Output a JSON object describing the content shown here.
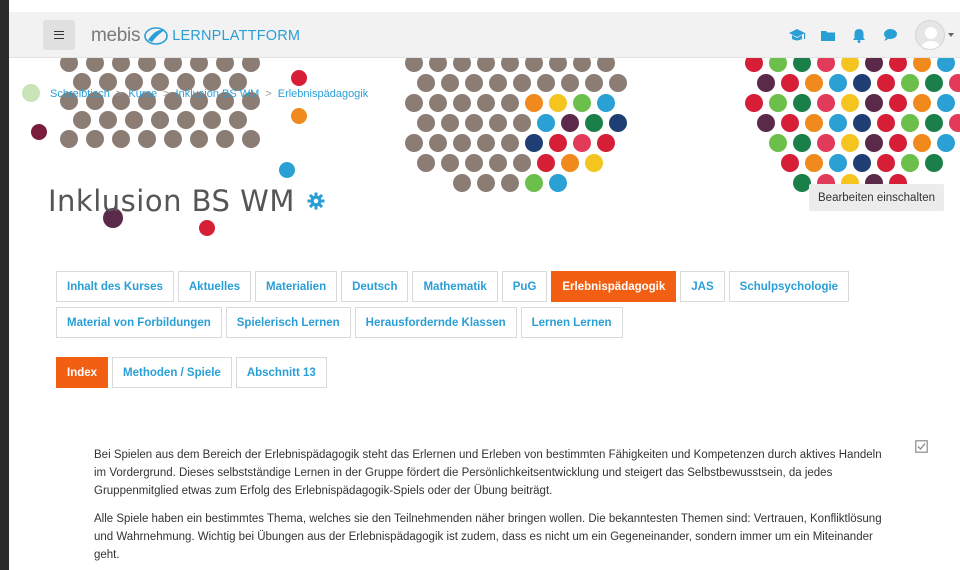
{
  "brand": {
    "name": "mebis",
    "suffix": "LERNPLATTFORM",
    "accent_color": "#2a9fd6"
  },
  "nav_icons": [
    "graduation-cap-icon",
    "folder-icon",
    "bell-icon",
    "chat-bubble-icon"
  ],
  "breadcrumb": {
    "items": [
      "Schreibtisch",
      "Kurse",
      "Inklusion BS WM",
      "Erlebnispädagogik"
    ],
    "separator": ">"
  },
  "course": {
    "title": "Inklusion BS WM"
  },
  "edit_button": "Bearbeiten einschalten",
  "tabs_row1": [
    "Inhalt des Kurses",
    "Aktuelles",
    "Materialien",
    "Deutsch",
    "Mathematik",
    "PuG",
    "Erlebnispädagogik",
    "JAS",
    "Schulpsychologie"
  ],
  "tabs_row1_active": "Erlebnispädagogik",
  "tabs_row2": [
    "Material von Forbildungen",
    "Spielerisch Lernen",
    "Herausfordernde Klassen",
    "Lernen Lernen"
  ],
  "tabs_row3": [
    "Index",
    "Methoden / Spiele",
    "Abschnitt 13"
  ],
  "tabs_row3_active": "Index",
  "active_color": "#f35f12",
  "content": {
    "paragraph1": "Bei Spielen aus dem Bereich der Erlebnispädagogik steht das Erlernen und Erleben von bestimmten Fähigkeiten und Kompetenzen durch aktives Handeln im Vordergrund. Dieses selbstständige Lernen in der Gruppe fördert die Persönlichkeitsentwicklung und steigert das Selbstbewusstsein, da jedes Gruppenmitglied etwas zum Erfolg des Erlebnispädagogik-Spiels oder der Übung beiträgt.",
    "paragraph2": "Alle Spiele haben ein bestimmtes Thema, welches sie den Teilnehmenden näher bringen wollen. Die bekanntesten Themen sind: Vertrauen, Konfliktlösung und Wahrnehmung. Wichtig bei Übungen aus der Erlebnispädagogik ist zudem, dass es nicht um ein Gegeneinander, sondern immer um ein Miteinander geht."
  }
}
